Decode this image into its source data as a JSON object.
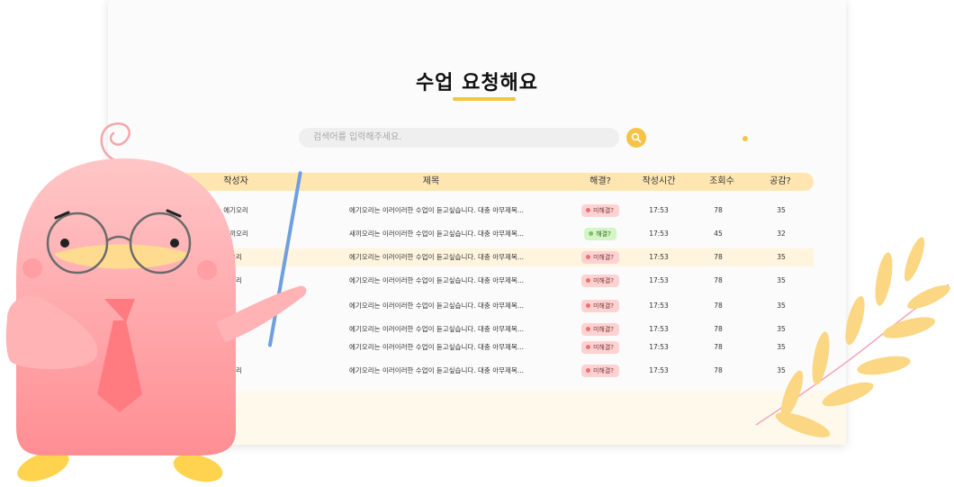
{
  "page": {
    "title": "수업 요청해요"
  },
  "search": {
    "placeholder": "검색어를 입력해주세요."
  },
  "table": {
    "headers": {
      "author": "작성자",
      "title": "제목",
      "resolved": "해결?",
      "time": "작성시간",
      "views": "조회수",
      "likes": "공감?"
    },
    "rows": [
      {
        "author": "에기오리",
        "title": "에기오리는 이러이러한 수업이 듣고싶습니다. 대충 아무제목...",
        "status": "미해결?",
        "time": "17:53",
        "views": "78",
        "likes": "35"
      },
      {
        "author": "새끼오리",
        "title": "새끼오리는 이러이러한 수업이 듣고싶습니다. 대충 아무제목...",
        "status": "해결?",
        "time": "17:53",
        "views": "45",
        "likes": "32"
      },
      {
        "author": "오리",
        "title": "에기오리는 이러이러한 수업이 듣고싶습니다. 대충 아무제목...",
        "status": "미해결?",
        "time": "17:53",
        "views": "78",
        "likes": "35"
      },
      {
        "author": "오리",
        "title": "에기오리는 이러이러한 수업이 듣고싶습니다. 대충 아무제목...",
        "status": "미해결?",
        "time": "17:53",
        "views": "78",
        "likes": "35"
      },
      {
        "author": "",
        "title": "에기오리는 이러이러한 수업이 듣고싶습니다. 대충 아무제목...",
        "status": "미해결?",
        "time": "17:53",
        "views": "78",
        "likes": "35"
      },
      {
        "author": "",
        "title": "에기오리는 이러이러한 수업이 듣고싶습니다. 대충 아무제목...",
        "status": "미해결?",
        "time": "17:53",
        "views": "78",
        "likes": "35"
      },
      {
        "author": "",
        "title": "에기오리는 이러이러한 수업이 듣고싶습니다. 대충 아무제목...",
        "status": "미해결?",
        "time": "17:53",
        "views": "78",
        "likes": "35"
      },
      {
        "author": "오리",
        "title": "에기오리는 이러이러한 수업이 듣고싶습니다. 대충 아무제목...",
        "status": "미해결?",
        "time": "17:53",
        "views": "78",
        "likes": "35"
      }
    ]
  },
  "colors": {
    "accent": "#f6c445",
    "header_band": "#ffe6b0",
    "highlight_row": "#fff4de",
    "unresolved_badge": "#ffd2d2",
    "resolved_badge": "#d4f5c6",
    "mascot_body": "#ffc2c4",
    "pointer": "#6f9fde"
  },
  "icons": {
    "search": "search-icon",
    "mascot": "duck-mascot-illustration",
    "branch": "leaf-branch-illustration"
  }
}
